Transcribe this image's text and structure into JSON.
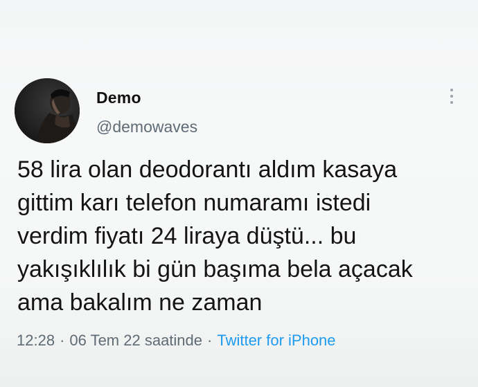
{
  "tweet": {
    "author": {
      "display_name": "Demo",
      "handle": "@demowaves"
    },
    "text": "58 lira olan deodorantı aldım kasaya\ngittim karı telefon numaramı istedi\nverdim fiyatı 24 liraya düştü... bu\nyakışıklılık bi gün başıma bela açacak\nama bakalım ne zaman",
    "time": "12:28",
    "date": "06 Tem 22 saatinde",
    "separator": "·",
    "source": "Twitter for iPhone"
  },
  "icons": {
    "more": "more-vertical-icon",
    "avatar": "profile-photo"
  },
  "colors": {
    "link": "#1d9bf0",
    "secondary_text": "#5f6b75",
    "primary_text": "#141414"
  }
}
